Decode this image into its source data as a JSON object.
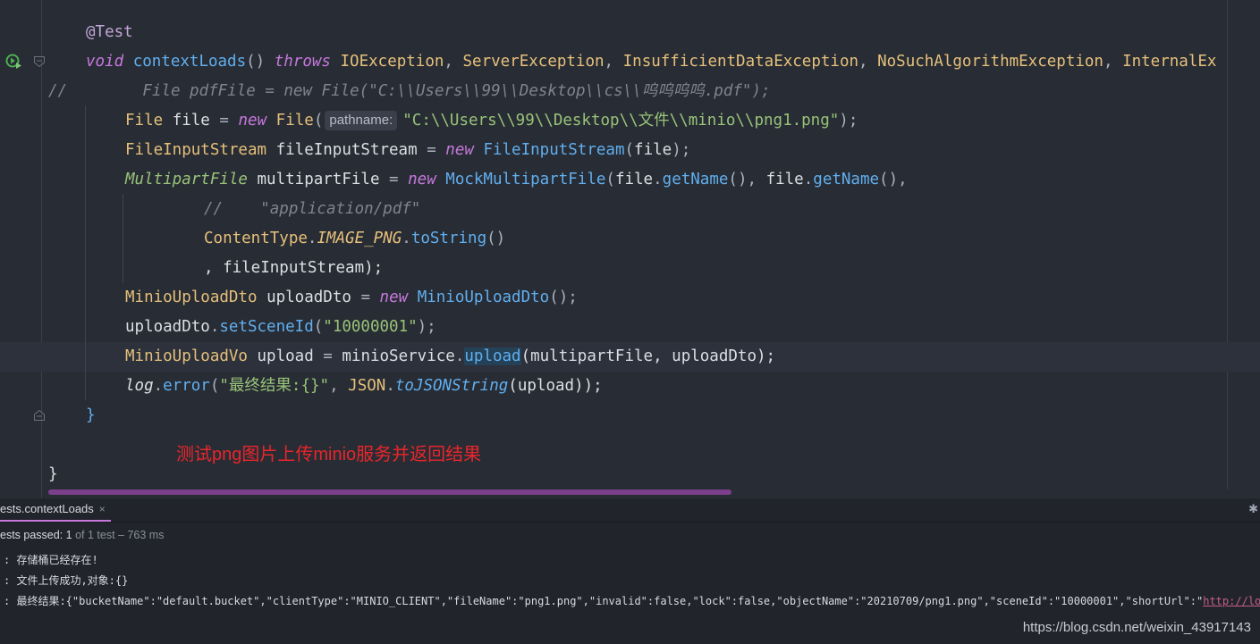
{
  "editor": {
    "annotation": "@Test",
    "kw_void": "void",
    "method_name": "contextLoads",
    "parens": "() ",
    "kw_throws": "throws",
    "exc1": "IOException",
    "exc2": "ServerException",
    "exc3": "InsufficientDataException",
    "exc4": "NoSuchAlgorithmException",
    "exc5": "InternalEx",
    "commented_line": "//        File pdfFile = new File(\"C:\\\\Users\\\\99\\\\Desktop\\\\cs\\\\呜呜呜呜.pdf\");",
    "l4_type": "File",
    "l4_var": "file",
    "kw_new": "new",
    "l4_ctor": "File",
    "l4_hint": "pathname:",
    "l4_path": "\"C:\\\\Users\\\\99\\\\Desktop\\\\文件\\\\minio\\\\png1.png\"",
    "l5_type": "FileInputStream",
    "l5_var": "fileInputStream",
    "l5_ctor": "FileInputStream",
    "l5_arg": "file",
    "l6_type": "MultipartFile",
    "l6_var": "multipartFile",
    "l6_ctor": "MockMultipartFile",
    "file_obj": "file",
    "get_name": "getName",
    "l7_comment": "//    \"application/pdf\"",
    "l8_class": "ContentType",
    "l8_const": "IMAGE_PNG",
    "l8_method": "toString",
    "l9_text": ", fileInputStream);",
    "l10_type": "MinioUploadDto",
    "l10_var": "uploadDto",
    "l10_ctor": "MinioUploadDto",
    "l11_obj": "uploadDto",
    "l11_method": "setSceneId",
    "l11_arg": "\"10000001\"",
    "l12_type": "MinioUploadVo",
    "l12_var": "upload",
    "l12_obj": "minioService",
    "l12_method": "upload",
    "l12_args": "(multipartFile, uploadDto);",
    "l13_log": "log",
    "l13_method": "error",
    "l13_str": "\"最终结果:{}\"",
    "l13_json": "JSON",
    "l13_json_method": "toJSONString",
    "l13_arg": "(upload));",
    "close_brace_method": "}",
    "close_brace_class": "}",
    "red_note": "测试png图片上传minio服务并返回结果"
  },
  "panel": {
    "tab_label": "ests.contextLoads",
    "tab_close": "×",
    "status_prefix": "ests passed: 1",
    "status_detail": "of 1 test – 763 ms",
    "log1": ": 存储桶已经存在!",
    "log2": ": 文件上传成功,对象:{}",
    "log3": ": 最终结果:{\"bucketName\":\"default.bucket\",\"clientType\":\"MINIO_CLIENT\",\"fileName\":\"png1.png\",\"invalid\":false,\"lock\":false,\"objectName\":\"20210709/png1.png\",\"sceneId\":\"10000001\",\"shortUrl\":\"",
    "log3_link": "http://localhos"
  },
  "watermark": "https://blog.csdn.net/weixin_43917143"
}
